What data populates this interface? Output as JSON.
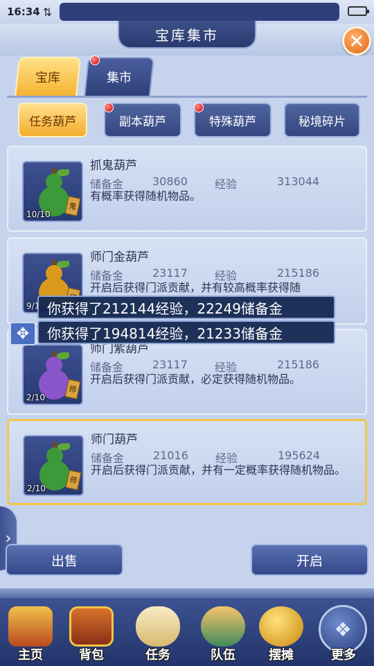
{
  "status_bar": {
    "time": "16:34",
    "sync_icon": "sync-arrows-icon",
    "battery_icon": "battery-icon"
  },
  "header": {
    "title": "宝库集市",
    "close_icon": "close-icon"
  },
  "tabs": [
    {
      "label": "宝库",
      "active": true,
      "badge": false
    },
    {
      "label": "集市",
      "active": false,
      "badge": true
    }
  ],
  "subtabs": [
    {
      "label": "任务葫芦",
      "active": true,
      "badge": false
    },
    {
      "label": "副本葫芦",
      "active": false,
      "badge": true
    },
    {
      "label": "特殊葫芦",
      "active": false,
      "badge": true
    },
    {
      "label": "秘境碎片",
      "active": false,
      "badge": false
    }
  ],
  "stat_labels": {
    "reserve_gold": "储备金",
    "exp": "经验"
  },
  "items": [
    {
      "name": "抓鬼葫芦",
      "reserve_gold": "30860",
      "exp": "313044",
      "description": "有概率获得随机物品。",
      "count": "10/10",
      "tag": "鬼",
      "color": "#3d9a3a"
    },
    {
      "name": "师门金葫芦",
      "reserve_gold": "23117",
      "exp": "215186",
      "description": "开启后获得门派贡献，并有较高概率获得随",
      "count": "9/10",
      "tag": "师",
      "color": "#d99a1c"
    },
    {
      "name": "师门紫葫芦",
      "reserve_gold": "23117",
      "exp": "215186",
      "description": "开启后获得门派贡献，必定获得随机物品。",
      "count": "2/10",
      "tag": "师",
      "color": "#8a55c9"
    },
    {
      "name": "师门葫芦",
      "reserve_gold": "21016",
      "exp": "195624",
      "description": "开启后获得门派贡献，并有一定概率获得随机物品。",
      "count": "2/10",
      "tag": "师",
      "color": "#3d9a3a"
    }
  ],
  "toasts": [
    "你获得了212144经验，22249储备金",
    "你获得了194814经验，21233储备金"
  ],
  "buttons": {
    "sell": "出售",
    "open": "开启"
  },
  "bottom_nav": [
    {
      "label": "主页",
      "icon": "home-icon"
    },
    {
      "label": "背包",
      "icon": "chest-icon"
    },
    {
      "label": "任务",
      "icon": "scroll-icon"
    },
    {
      "label": "队伍",
      "icon": "team-icon"
    },
    {
      "label": "摆摊",
      "icon": "coin-icon"
    },
    {
      "label": "更多",
      "icon": "more-icon"
    }
  ],
  "colors": {
    "accent_gold": "#f3ad2e",
    "navy": "#2f4079",
    "panel": "#c6d3ec",
    "selected_border": "#f2c744"
  }
}
